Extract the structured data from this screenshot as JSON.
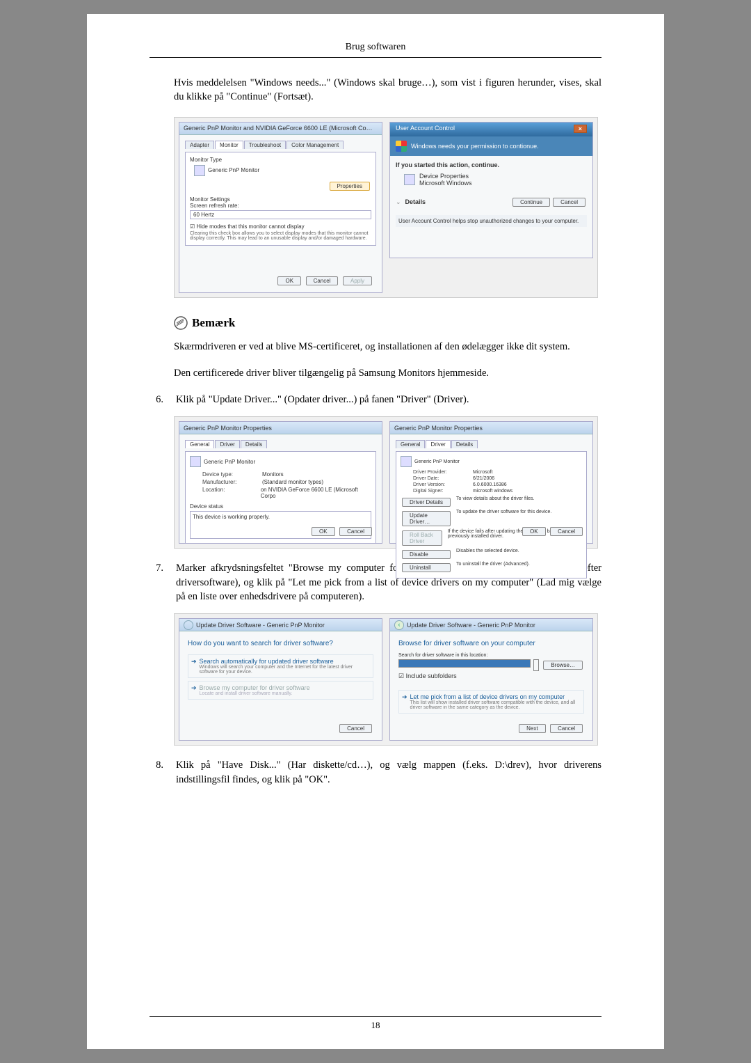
{
  "header": {
    "title": "Brug softwaren"
  },
  "paragraphs": {
    "p1": "Hvis meddelelsen \"Windows needs...\" (Windows skal bruge…), som vist i figuren herunder, vises, skal du klikke på \"Continue\" (Fortsæt)."
  },
  "note": {
    "label": "Bemærk",
    "line1": "Skærmdriveren er ved at blive MS-certificeret, og installationen af den ødelægger ikke dit system.",
    "line2": "Den certificerede driver bliver tilgængelig på Samsung Monitors hjemmeside."
  },
  "steps": {
    "s6_num": "6.",
    "s6_text": "Klik på \"Update Driver...\" (Opdater driver...) på fanen \"Driver\" (Driver).",
    "s7_num": "7.",
    "s7_text": "Marker afkrydsningsfeltet \"Browse my computer for driver software\" (Gennemse computeren efter driversoftware), og klik på \"Let me pick from a list of device drivers on my computer\" (Lad mig vælge på en liste over enhedsdrivere på computeren).",
    "s8_num": "8.",
    "s8_text": "Klik på \"Have Disk...\" (Har diskette/cd…), og vælg mappen (f.eks. D:\\drev), hvor driverens indstillingsfil findes, og klik på \"OK\"."
  },
  "footer": {
    "page_number": "18"
  },
  "dlg1_left": {
    "title": "Generic PnP Monitor and NVIDIA GeForce 6600 LE (Microsoft Co…",
    "tabs": {
      "adapter": "Adapter",
      "monitor": "Monitor",
      "troubleshoot": "Troubleshoot",
      "color": "Color Management"
    },
    "monitor_type_label": "Monitor Type",
    "monitor_type_value": "Generic PnP Monitor",
    "properties_btn": "Properties",
    "settings_label": "Monitor Settings",
    "refresh_label": "Screen refresh rate:",
    "refresh_value": "60 Hertz",
    "hide_modes": "Hide modes that this monitor cannot display",
    "hide_desc": "Clearing this check box allows you to select display modes that this monitor cannot display correctly. This may lead to an unusable display and/or damaged hardware.",
    "ok": "OK",
    "cancel": "Cancel",
    "apply": "Apply"
  },
  "dlg1_right": {
    "title": "User Account Control",
    "banner": "Windows needs your permission to contionue.",
    "started": "If you started this action, continue.",
    "device_props": "Device Properties",
    "ms_windows": "Microsoft Windows",
    "details": "Details",
    "continue": "Continue",
    "cancel": "Cancel",
    "footer": "User Account Control helps stop unauthorized changes to your computer."
  },
  "dlg2_left": {
    "title": "Generic PnP Monitor Properties",
    "tabs": {
      "general": "General",
      "driver": "Driver",
      "details": "Details"
    },
    "heading": "Generic PnP Monitor",
    "device_type_lbl": "Device type:",
    "device_type_val": "Monitors",
    "manufacturer_lbl": "Manufacturer:",
    "manufacturer_val": "(Standard monitor types)",
    "location_lbl": "Location:",
    "location_val": "on NVIDIA GeForce 6600 LE (Microsoft Corpo",
    "status_lbl": "Device status",
    "status_val": "This device is working properly.",
    "ok": "OK",
    "cancel": "Cancel"
  },
  "dlg2_right": {
    "title": "Generic PnP Monitor Properties",
    "tabs": {
      "general": "General",
      "driver": "Driver",
      "details": "Details"
    },
    "heading": "Generic PnP Monitor",
    "provider_lbl": "Driver Provider:",
    "provider_val": "Microsoft",
    "date_lbl": "Driver Date:",
    "date_val": "6/21/2006",
    "version_lbl": "Driver Version:",
    "version_val": "6.0.6000.16386",
    "signer_lbl": "Digital Signer:",
    "signer_val": "microsoft windows",
    "btn_details": "Driver Details",
    "btn_details_desc": "To view details about the driver files.",
    "btn_update": "Update Driver…",
    "btn_update_desc": "To update the driver software for this device.",
    "btn_rollback": "Roll Back Driver",
    "btn_rollback_desc": "If the device fails after updating the driver, roll back to the previously installed driver.",
    "btn_disable": "Disable",
    "btn_disable_desc": "Disables the selected device.",
    "btn_uninstall": "Uninstall",
    "btn_uninstall_desc": "To uninstall the driver (Advanced).",
    "ok": "OK",
    "cancel": "Cancel"
  },
  "dlg3_left": {
    "title": "Update Driver Software - Generic PnP Monitor",
    "question": "How do you want to search for driver software?",
    "opt1_head": "Search automatically for updated driver software",
    "opt1_desc": "Windows will search your computer and the Internet for the latest driver software for your device.",
    "opt2_head": "Browse my computer for driver software",
    "opt2_desc": "Locate and install driver software manually.",
    "cancel": "Cancel"
  },
  "dlg3_right": {
    "title": "Update Driver Software - Generic PnP Monitor",
    "heading": "Browse for driver software on your computer",
    "search_label": "Search for driver software in this location:",
    "browse": "Browse…",
    "include": "Include subfolders",
    "opt_head": "Let me pick from a list of device drivers on my computer",
    "opt_desc": "This list will show installed driver software compatible with the device, and all driver software in the same category as the device.",
    "next": "Next",
    "cancel": "Cancel"
  }
}
